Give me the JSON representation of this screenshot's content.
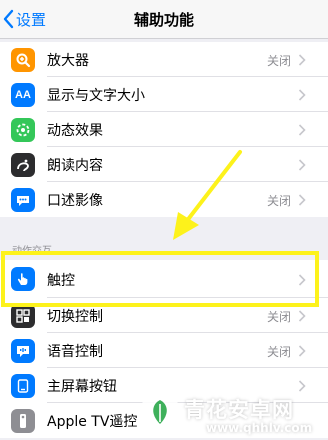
{
  "nav": {
    "back_label": "设置",
    "title": "辅助功能"
  },
  "vision_items": [
    {
      "label": "放大器",
      "value": "关闭",
      "icon": "magnifier-icon",
      "color": "#ff9500"
    },
    {
      "label": "显示与文字大小",
      "value": "",
      "icon": "text-size-icon",
      "color": "#007aff"
    },
    {
      "label": "动态效果",
      "value": "",
      "icon": "motion-icon",
      "color": "#34c759"
    },
    {
      "label": "朗读内容",
      "value": "",
      "icon": "speech-icon",
      "color": "#2c2c2e"
    },
    {
      "label": "口述影像",
      "value": "关闭",
      "icon": "audio-description-icon",
      "color": "#007aff"
    }
  ],
  "section_header": "动作交互",
  "interaction_items": [
    {
      "label": "触控",
      "value": "",
      "icon": "touch-hand-icon",
      "color": "#007aff"
    },
    {
      "label": "切换控制",
      "value": "关闭",
      "icon": "switch-control-icon",
      "color": "#2c2c2e"
    },
    {
      "label": "语音控制",
      "value": "关闭",
      "icon": "voice-control-icon",
      "color": "#007aff"
    },
    {
      "label": "主屏幕按钮",
      "value": "",
      "icon": "home-button-icon",
      "color": "#007aff"
    },
    {
      "label": "Apple TV遥控",
      "value": "",
      "icon": "apple-tv-remote-icon",
      "color": "#8e8e93"
    }
  ],
  "highlight_color": "#fdf21b",
  "watermark": {
    "name": "青花安卓网",
    "url": "www.qhhlv.com"
  }
}
